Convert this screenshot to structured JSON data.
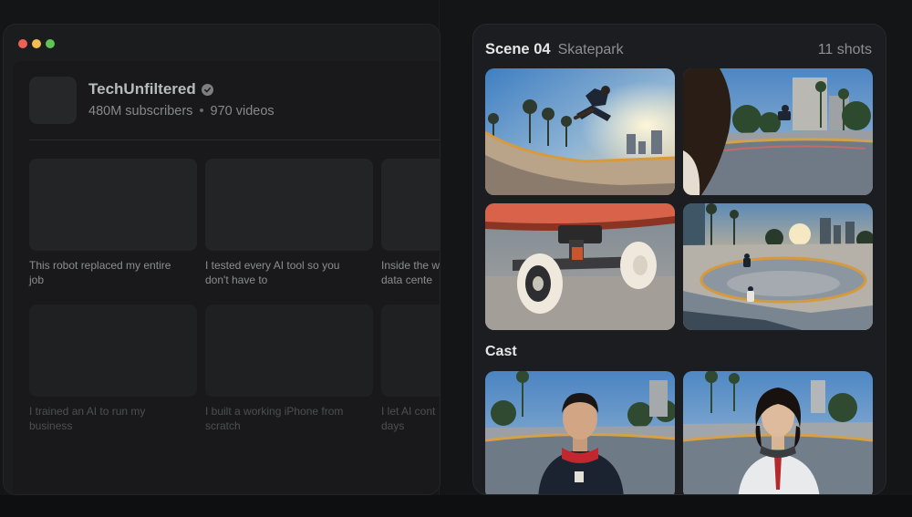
{
  "channel": {
    "name": "TechUnfiltered",
    "subscribers": "480M subscribers",
    "separator": "•",
    "videos_count": "970 videos",
    "verified_icon": "check-circle"
  },
  "videos": [
    {
      "title": "This robot replaced my entire\njob"
    },
    {
      "title": "I tested every AI tool so you\ndon't have to"
    },
    {
      "title": "Inside the w\ndata cente"
    },
    {
      "title": "I trained an AI to run my\nbusiness"
    },
    {
      "title": "I built a working iPhone from\nscratch"
    },
    {
      "title": "I let AI cont\ndays"
    }
  ],
  "scene": {
    "label": "Scene 04",
    "name": "Skatepark",
    "shot_count": "11 shots"
  },
  "shots": [
    {
      "subject": "skater-jump-bowl"
    },
    {
      "subject": "over-shoulder-skatepark"
    },
    {
      "subject": "skateboard-truck-closeup"
    },
    {
      "subject": "wide-skatepark-sunset"
    }
  ],
  "cast": {
    "label": "Cast",
    "members": [
      {
        "subject": "young-man-red-hoodie"
      },
      {
        "subject": "young-man-headphones"
      }
    ]
  },
  "colors": {
    "window_bg": "#1b1c1e",
    "panel_bg": "#1c1d20",
    "text_primary": "#e6e6e7",
    "text_secondary": "#8e8f92"
  }
}
